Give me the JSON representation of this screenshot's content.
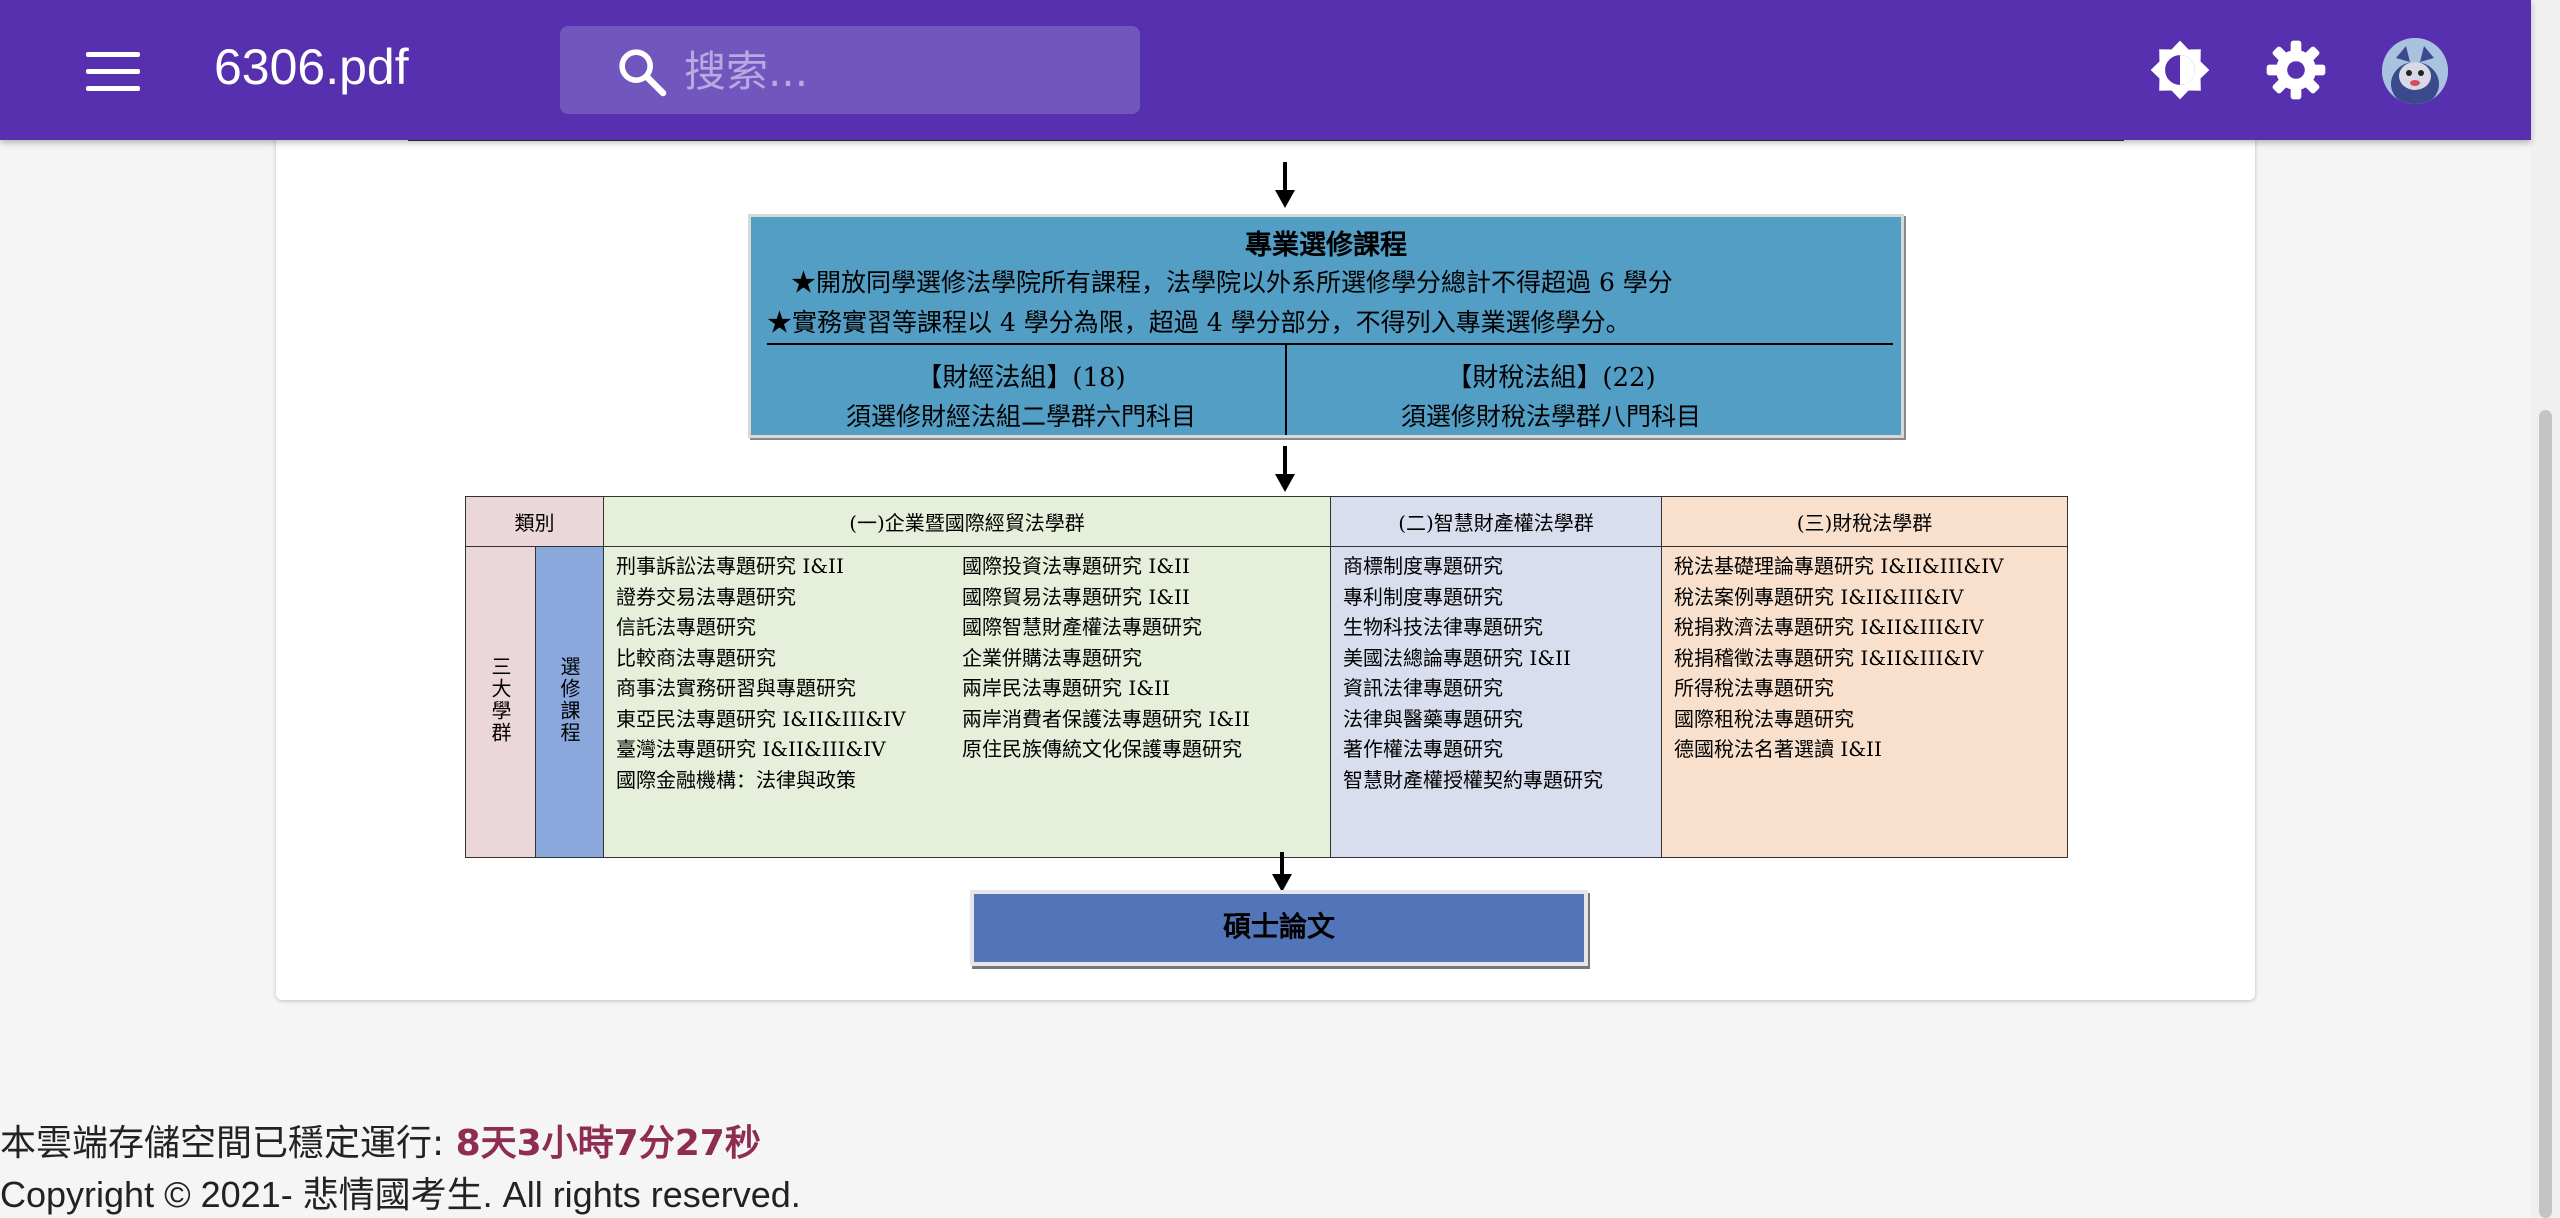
{
  "app": {
    "title": "6306.pdf",
    "search_placeholder": "搜索...",
    "icons": {
      "menu": "menu-icon",
      "search": "search-icon",
      "theme": "brightness-icon",
      "settings": "gear-icon",
      "avatar": "avatar"
    },
    "accent_color": "#5630ae"
  },
  "document": {
    "elective": {
      "title": "專業選修課程",
      "line1": "★開放同學選修法學院所有課程，法學院以外系所選修學分總計不得超過 6 學分",
      "line2": "★實務實習等課程以 4 學分為限，超過 4 學分部分，不得列入專業選修學分。",
      "finance_group": "【財經法組】(18)",
      "finance_req": "須選修財經法組二學群六門科目",
      "tax_group": "【財稅法組】(22)",
      "tax_req": "須選修財稅法學群八門科目"
    },
    "table": {
      "category_header": "類別",
      "group1_header": "(一)企業暨國際經貿法學群",
      "group2_header": "(二)智慧財產權法學群",
      "group3_header": "(三)財稅法學群",
      "side_a": "三大學群",
      "side_b": "選修課程",
      "group1_col1": [
        "刑事訴訟法專題研究 I&II",
        "證券交易法專題研究",
        "信託法專題研究",
        "比較商法專題研究",
        "商事法實務研習與專題研究",
        "東亞民法專題研究 I&II&III&IV",
        "臺灣法專題研究 I&II&III&IV",
        "國際金融機構：法律與政策"
      ],
      "group1_col2": [
        "國際投資法專題研究 I&II",
        "國際貿易法專題研究 I&II",
        "國際智慧財產權法專題研究",
        "企業併購法專題研究",
        "兩岸民法專題研究 I&II",
        "兩岸消費者保護法專題研究 I&II",
        "原住民族傳統文化保護專題研究"
      ],
      "group2": [
        "商標制度專題研究",
        "專利制度專題研究",
        "生物科技法律專題研究",
        "美國法總論專題研究 I&II",
        "資訊法律專題研究",
        "法律與醫藥專題研究",
        "著作權法專題研究",
        "智慧財產權授權契約專題研究"
      ],
      "group3": [
        "稅法基礎理論專題研究 I&II&III&IV",
        "稅法案例專題研究 I&II&III&IV",
        "稅捐救濟法專題研究 I&II&III&IV",
        "稅捐稽徵法專題研究 I&II&III&IV",
        "所得稅法專題研究",
        "國際租稅法專題研究",
        "德國稅法名著選讀  I&II"
      ]
    },
    "thesis": "碩士論文"
  },
  "footer": {
    "status_label": "本雲端存儲空間已穩定運行: ",
    "uptime": "8天3小時7分27秒",
    "copyright": "Copyright © 2021- 悲情國考生. All rights reserved."
  }
}
